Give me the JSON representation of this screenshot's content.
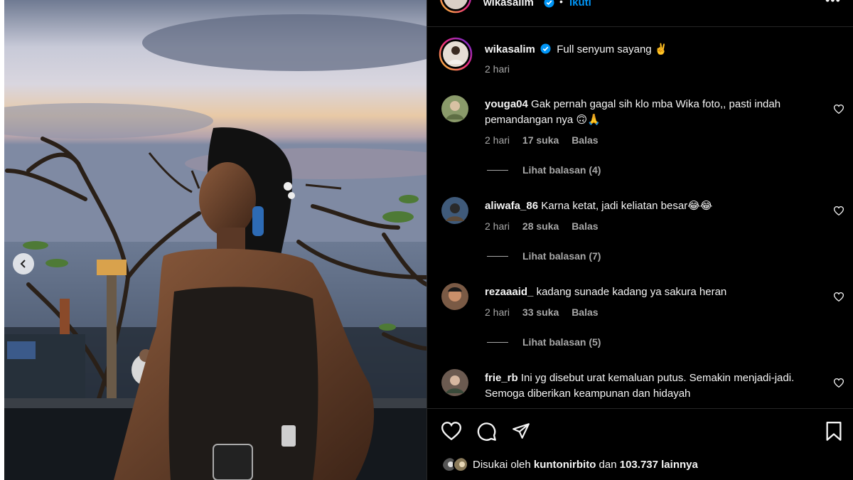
{
  "post_author": {
    "username": "wikasalim",
    "follow_label": "Ikuti",
    "more_label": "•••"
  },
  "caption": {
    "username": "wikasalim",
    "text": "Full senyum sayang ✌️",
    "time": "2 hari"
  },
  "comments": [
    {
      "username": "youga04",
      "text": "Gak pernah gagal sih klo mba Wika foto,, pasti indah pemandangan nya 🙃🙏",
      "time": "2 hari",
      "likes": "17 suka",
      "reply_label": "Balas",
      "view_replies": "Lihat balasan (4)"
    },
    {
      "username": "aliwafa_86",
      "text": "Karna ketat, jadi keliatan besar😂😂",
      "time": "2 hari",
      "likes": "28 suka",
      "reply_label": "Balas",
      "view_replies": "Lihat balasan (7)"
    },
    {
      "username": "rezaaaid_",
      "text": "kadang sunade kadang ya sakura heran",
      "time": "2 hari",
      "likes": "33 suka",
      "reply_label": "Balas",
      "view_replies": "Lihat balasan (5)"
    },
    {
      "username": "frie_rb",
      "text": "Ini yg disebut urat kemaluan putus. Semakin menjadi-jadi. Semoga diberikan keampunan dan hidayah"
    }
  ],
  "likes_summary": {
    "prefix": "Disukai oleh",
    "user": "kuntonirbito",
    "joiner": "dan",
    "count": "103.737 lainnya"
  },
  "icons": {
    "like": "heart-icon",
    "comment": "comment-icon",
    "share": "send-icon",
    "save": "bookmark-icon",
    "verified": "verified-badge-icon",
    "carousel_prev": "chevron-left-icon"
  },
  "colors": {
    "background": "#000000",
    "text": "#f5f5f5",
    "secondary": "#a8a8a8",
    "link": "#0095f6",
    "verified": "#0095f6",
    "divider": "#262626"
  }
}
